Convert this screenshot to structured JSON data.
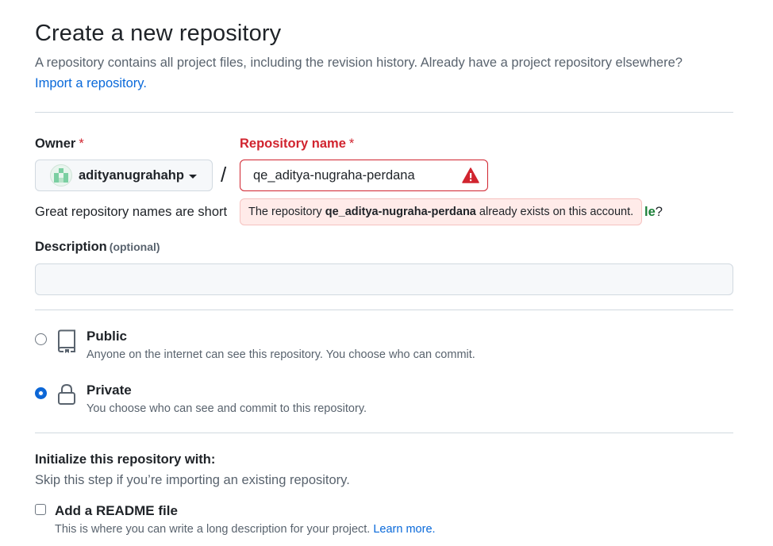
{
  "page": {
    "title": "Create a new repository",
    "subtitle": "A repository contains all project files, including the revision history. Already have a project repository elsewhere?",
    "import_link": "Import a repository."
  },
  "owner": {
    "label": "Owner",
    "required_mark": "*",
    "name": "adityanugrahahp"
  },
  "repo": {
    "label": "Repository name",
    "required_mark": "*",
    "separator": "/",
    "value": "qe_aditya-nugraha-perdana",
    "error_prefix": "The repository",
    "error_name": "qe_aditya-nugraha-perdana",
    "error_suffix": "already exists on this account.",
    "help_start": "Great repository names are short",
    "help_tail_bold": "le",
    "help_tail_end": "?"
  },
  "description": {
    "label": "Description",
    "optional": "(optional)",
    "value": ""
  },
  "visibility": {
    "selected": "private",
    "options": [
      {
        "id": "public",
        "label": "Public",
        "desc": "Anyone on the internet can see this repository. You choose who can commit.",
        "icon": "repo-icon"
      },
      {
        "id": "private",
        "label": "Private",
        "desc": "You choose who can see and commit to this repository.",
        "icon": "lock-icon"
      }
    ]
  },
  "initialize": {
    "title": "Initialize this repository with:",
    "desc": "Skip this step if you’re importing an existing repository.",
    "readme_label": "Add a README file",
    "readme_checked": false,
    "readme_desc": "This is where you can write a long description for your project.",
    "learn_more": "Learn more."
  },
  "colors": {
    "accent": "#0969da",
    "error": "#d1242f",
    "error_bg": "#ffebe9",
    "success": "#1a7f37"
  }
}
